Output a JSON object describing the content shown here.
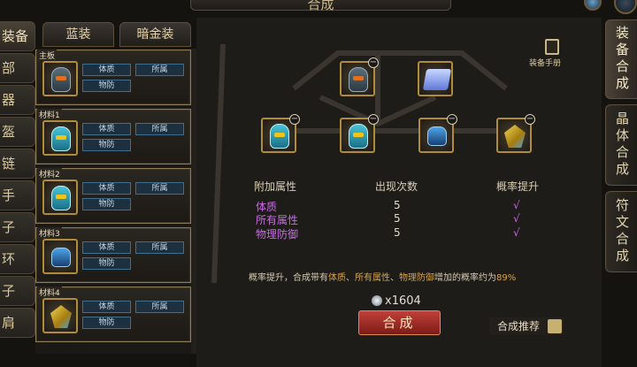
{
  "header": {
    "title": "合成"
  },
  "left_menu": [
    {
      "label": "装备"
    },
    {
      "label": "部"
    },
    {
      "label": "器"
    },
    {
      "label": "盔"
    },
    {
      "label": "链"
    },
    {
      "label": "手"
    },
    {
      "label": "子"
    },
    {
      "label": "环"
    },
    {
      "label": "子"
    },
    {
      "label": "肩"
    }
  ],
  "sub_tabs": [
    {
      "label": "蓝装"
    },
    {
      "label": "暗金装"
    }
  ],
  "materials": [
    {
      "slot_label": "主板",
      "attr1": "体质",
      "attr2": "所属",
      "attr3": "物防",
      "icon": "helmet-icon",
      "badge": "green"
    },
    {
      "slot_label": "材料1",
      "attr1": "体质",
      "attr2": "所属",
      "attr3": "物防",
      "icon": "helmet-icon",
      "badge": "green"
    },
    {
      "slot_label": "材料2",
      "attr1": "体质",
      "attr2": "所属",
      "attr3": "物防",
      "icon": "helmet-icon",
      "badge": "green"
    },
    {
      "slot_label": "材料3",
      "attr1": "体质",
      "attr2": "所属",
      "attr3": "物防",
      "icon": "gauntlet-icon",
      "badge": "blue"
    },
    {
      "slot_label": "材料4",
      "attr1": "体质",
      "attr2": "所属",
      "attr3": "物防",
      "icon": "gem-icon",
      "badge": "blue"
    }
  ],
  "manual": {
    "label": "装备手册"
  },
  "table": {
    "headers": [
      "附加属性",
      "出现次数",
      "概率提升"
    ],
    "rows": [
      {
        "attr": "体质",
        "count": "5",
        "mark": "√"
      },
      {
        "attr": "所有属性",
        "count": "5",
        "mark": "√"
      },
      {
        "attr": "物理防御",
        "count": "5",
        "mark": "√"
      }
    ]
  },
  "probability": {
    "prefix": "概率提升，合成带有",
    "a1": "体质",
    "sep1": "、",
    "a2": "所有属性",
    "sep2": "、",
    "a3": "物理防御",
    "mid": "增加的概率约为",
    "pct": "89%"
  },
  "cost": {
    "value": "x1604"
  },
  "buttons": {
    "craft": "合成",
    "recommend": "合成推荐"
  },
  "right_tabs": [
    {
      "label": "装备合成"
    },
    {
      "label": "晶体合成"
    },
    {
      "label": "符文合成"
    }
  ],
  "colors": {
    "accent_gold": "#b08c3a",
    "purple_attr": "#c86ae6",
    "craft_red": "#c0403a"
  }
}
